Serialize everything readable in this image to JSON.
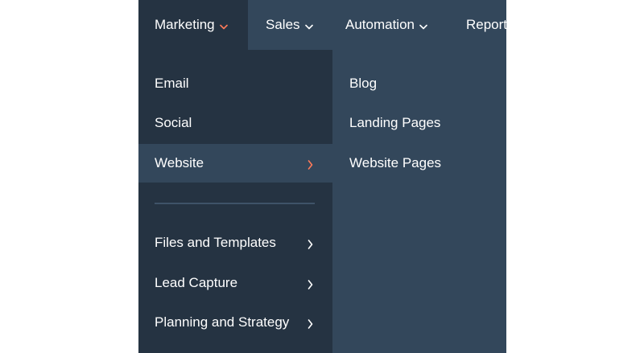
{
  "colors": {
    "nav_active_bg": "#253342",
    "nav_bg": "#33475b",
    "accent": "#ff7a59",
    "text": "#ffffff",
    "divider": "#3e5368"
  },
  "topnav": {
    "items": [
      {
        "label": "Marketing",
        "icon": "chevron-down-icon"
      },
      {
        "label": "Sales",
        "icon": "chevron-down-icon"
      },
      {
        "label": "Automation",
        "icon": "chevron-down-icon"
      },
      {
        "label": "Reports"
      }
    ]
  },
  "menu": {
    "items": [
      {
        "label": "Email"
      },
      {
        "label": "Social"
      },
      {
        "label": "Website",
        "icon": "chevron-right-icon"
      }
    ],
    "groups": [
      {
        "label": "Files and Templates",
        "icon": "chevron-right-icon"
      },
      {
        "label": "Lead Capture",
        "icon": "chevron-right-icon"
      },
      {
        "label": "Planning and Strategy",
        "icon": "chevron-right-icon"
      }
    ]
  },
  "submenu": {
    "items": [
      {
        "label": "Blog"
      },
      {
        "label": "Landing Pages"
      },
      {
        "label": "Website Pages"
      }
    ]
  }
}
